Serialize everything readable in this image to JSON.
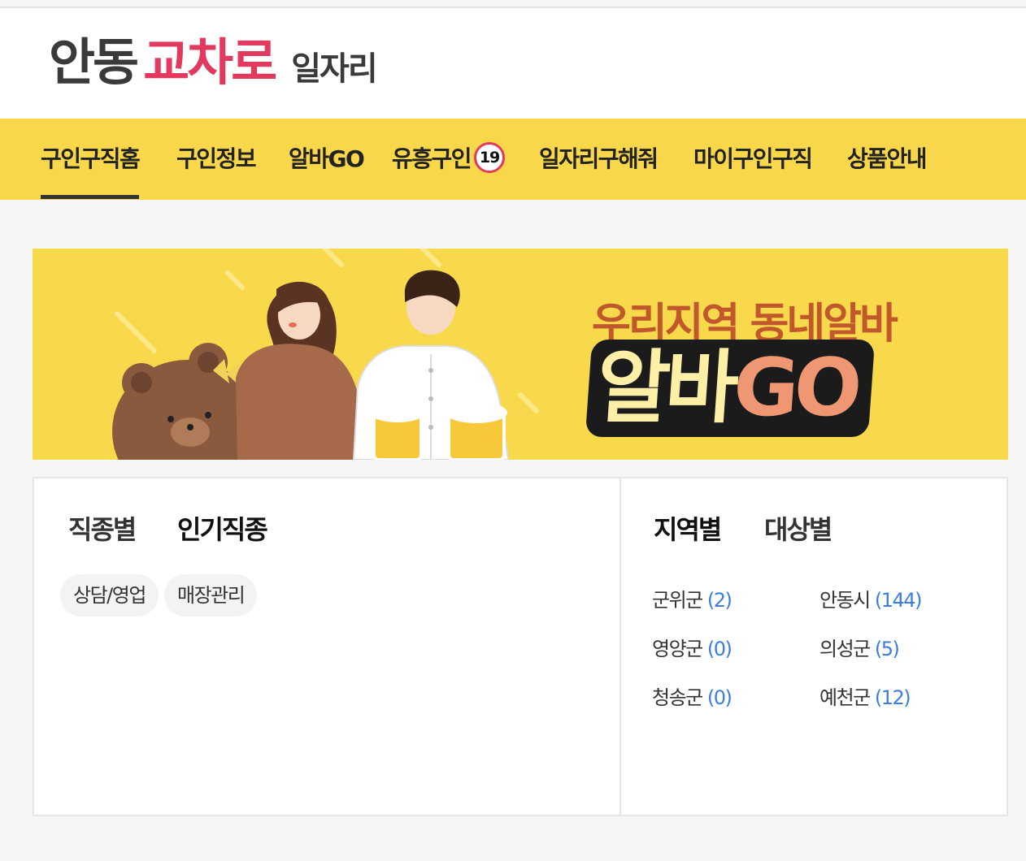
{
  "logo": {
    "part1": "안동",
    "part2": "교차로",
    "part3": "일자리",
    "accent": "#e23a5e"
  },
  "nav": {
    "items": [
      "구인구직홈",
      "구인정보",
      "알바GO",
      "유흥구인",
      "일자리구해줘",
      "마이구인구직",
      "상품안내"
    ],
    "badge": "19",
    "active": 0,
    "color": "#f8d74a"
  },
  "banner": {
    "subtitle": "우리지역 동네알바",
    "title_a": "알바",
    "title_b": "GO"
  },
  "job_panel": {
    "tabs": [
      "직종별",
      "인기직종"
    ],
    "active_tab": 1,
    "chips": [
      "상담/영업",
      "매장관리"
    ]
  },
  "region_panel": {
    "tabs": [
      "지역별",
      "대상별"
    ],
    "active_tab": 0,
    "regions": [
      {
        "name": "군위군",
        "count": "(2)"
      },
      {
        "name": "안동시",
        "count": "(144)"
      },
      {
        "name": "영양군",
        "count": "(0)"
      },
      {
        "name": "의성군",
        "count": "(5)"
      },
      {
        "name": "청송군",
        "count": "(0)"
      },
      {
        "name": "예천군",
        "count": "(12)"
      }
    ]
  }
}
